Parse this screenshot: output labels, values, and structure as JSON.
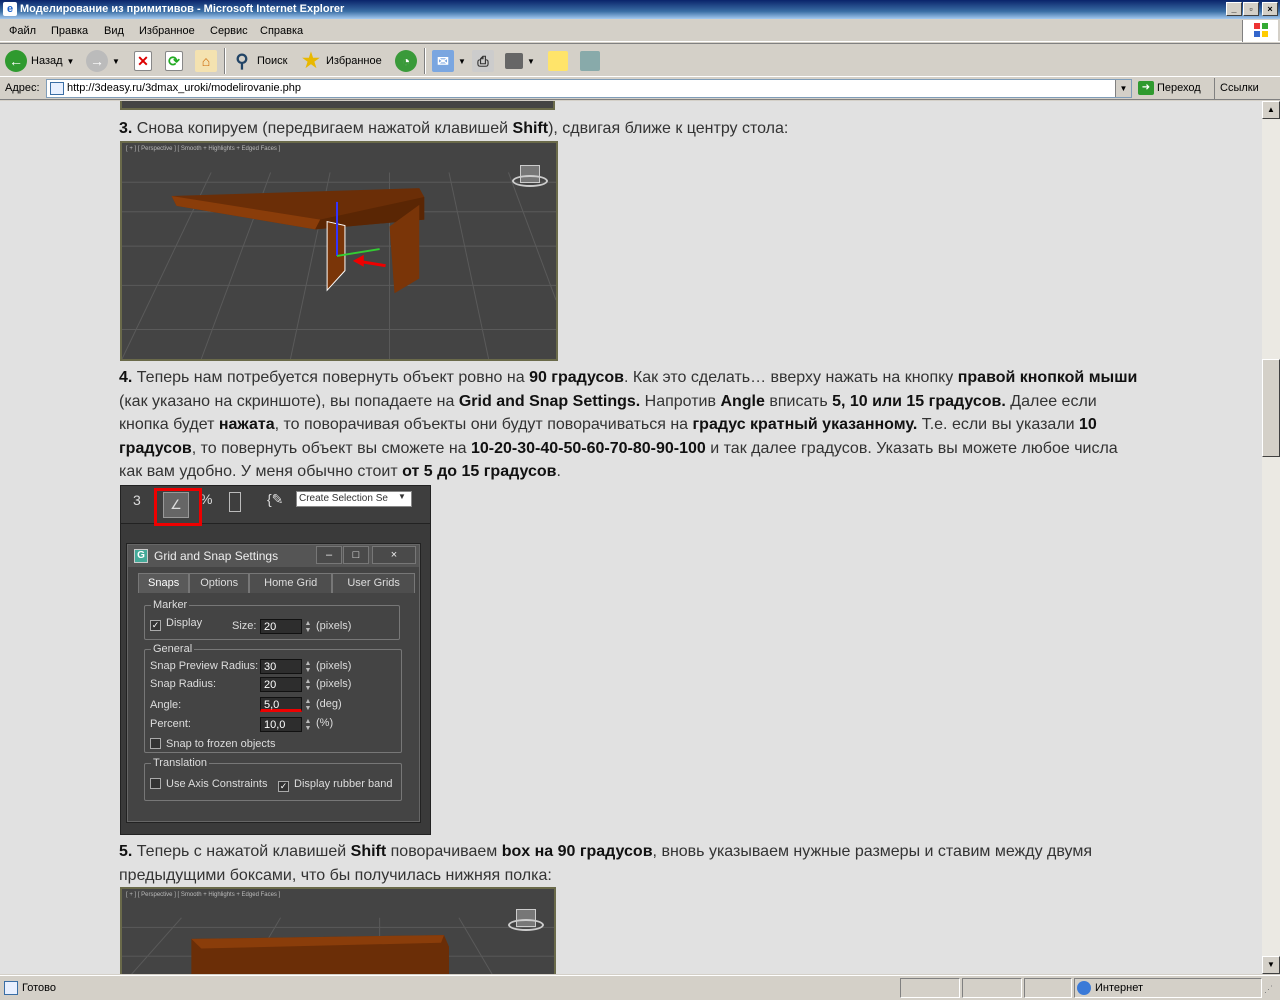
{
  "window": {
    "title": "Моделирование из примитивов - Microsoft Internet Explorer"
  },
  "menu": [
    "Файл",
    "Правка",
    "Вид",
    "Избранное",
    "Сервис",
    "Справка"
  ],
  "toolbar": {
    "back": "Назад",
    "search": "Поиск",
    "favorites": "Избранное"
  },
  "address": {
    "label": "Адрес:",
    "url": "http://3deasy.ru/3dmax_uroki/modelirovanie.php",
    "go": "Переход",
    "links": "Ссылки"
  },
  "article": {
    "p3_num": "3.",
    "p3_a": " Снова копируем (передвигаем нажатой клавишей ",
    "p3_shift": "Shift",
    "p3_b": "), сдвигая ближе к центру стола:",
    "p4_num": "4.",
    "p4_a": " Теперь нам потребуется повернуть объект ровно на ",
    "p4_90": "90 градусов",
    "p4_b": ". Как это сделать… вверху нажать на кнопку ",
    "p4_right": "правой кнопкой мыши",
    "p4_c": " (как указано на скриншоте), вы попадаете на ",
    "p4_gss": "Grid and Snap Settings.",
    "p4_d": " Напротив ",
    "p4_angle": "Angle",
    "p4_e": " вписать ",
    "p4_vals": "5, 10 или 15 градусов.",
    "p4_f": " Далее если кнопка будет ",
    "p4_pressed": "нажата",
    "p4_g": ", то поворачивая объекты они будут поворачиваться на ",
    "p4_multiple": "градус кратный указанному.",
    "p4_h": " Т.е. если вы указали ",
    "p4_10": "10 градусов",
    "p4_i": ", то повернуть объект вы сможете на ",
    "p4_seq": "10-20-30-40-50-60-70-80-90-100",
    "p4_j": " и так далее градусов. Указать вы можете любое числа как вам удобно. У меня обычно стоит ",
    "p4_range": "от 5 до 15 градусов",
    "p4_k": ".",
    "p5_num": "5.",
    "p5_a": " Теперь с нажатой клавишей ",
    "p5_shift": "Shift",
    "p5_b": " поворачиваем ",
    "p5_box": "box на 90 градусов",
    "p5_c": ", вновь указываем нужные размеры и ставим между двумя предыдущими боксами, что бы получилась нижняя полка:"
  },
  "viewport": {
    "label": "[ + ] [ Perspective ] [ Smooth + Highlights + Edged Faces ]"
  },
  "max_toolbar": {
    "snap3": "3",
    "pct": "%",
    "dropdown": "Create Selection Se"
  },
  "dialog": {
    "title": "Grid and Snap Settings",
    "tabs": [
      "Snaps",
      "Options",
      "Home Grid",
      "User Grids"
    ],
    "marker_group": "Marker",
    "display": "Display",
    "size_label": "Size:",
    "size_value": "20",
    "pixels": "(pixels)",
    "general_group": "General",
    "snap_preview_label": "Snap Preview Radius:",
    "snap_preview_value": "30",
    "snap_radius_label": "Snap Radius:",
    "snap_radius_value": "20",
    "angle_label": "Angle:",
    "angle_value": "5,0",
    "deg": "(deg)",
    "percent_label": "Percent:",
    "percent_value": "10,0",
    "pct_unit": "(%)",
    "frozen": "Snap to frozen objects",
    "translation_group": "Translation",
    "axis_constraints": "Use Axis Constraints",
    "rubber_band": "Display rubber band"
  },
  "status": {
    "left": "Готово",
    "zone": "Интернет"
  }
}
